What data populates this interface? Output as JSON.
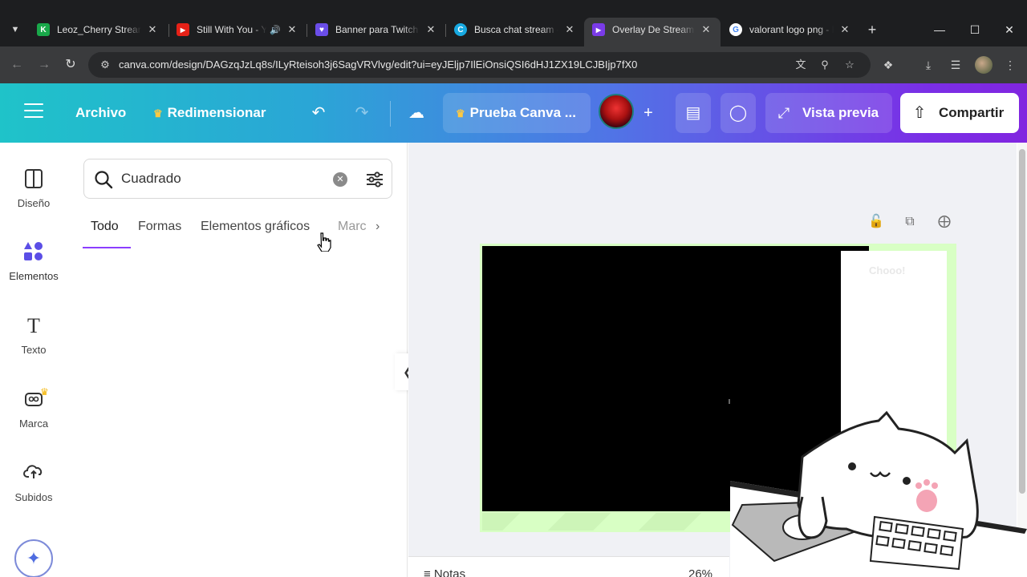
{
  "browser": {
    "tabs": [
      {
        "title": "Leoz_Cherry Stream -",
        "icon": "kick-icon",
        "color": "#19a84a",
        "glyph": "K"
      },
      {
        "title": "Still With You - Yo",
        "icon": "youtube-icon",
        "color": "#e62117",
        "glyph": "▶",
        "audio": "🔊"
      },
      {
        "title": "Banner para Twitch G",
        "icon": "shield-icon",
        "color": "#6a4de8",
        "glyph": "♥"
      },
      {
        "title": "Busca chat stream - C",
        "icon": "canva-icon",
        "color": "#17a9e1",
        "glyph": "C"
      },
      {
        "title": "Overlay De Streaming",
        "icon": "canva-icon",
        "color": "#7a3be8",
        "glyph": "▶"
      },
      {
        "title": "valorant logo png - B",
        "icon": "google-icon",
        "color": "#ffffff",
        "glyph": "G"
      }
    ],
    "new_tab": "+",
    "url": "canva.com/design/DAGzqJzLq8s/ILyRteisoh3j6SagVRVlvg/edit?ui=eyJEljp7IlEiOnsiQSI6dHJ1ZX19LCJBIjp7fX0"
  },
  "header": {
    "menu": "Archivo",
    "resize": "Redimensionar",
    "trial": "Prueba Canva ...",
    "preview": "Vista previa",
    "share": "Compartir",
    "accent": "#8b3dff"
  },
  "rail": {
    "items": [
      {
        "label": "Diseño",
        "icon": "layout-icon"
      },
      {
        "label": "Elementos",
        "icon": "elements-icon"
      },
      {
        "label": "Texto",
        "icon": "text-icon"
      },
      {
        "label": "Marca",
        "icon": "brand-icon"
      },
      {
        "label": "Subidos",
        "icon": "upload-cloud-icon"
      }
    ]
  },
  "panel": {
    "search_value": "Cuadrado",
    "tabs": [
      "Todo",
      "Formas",
      "Elementos gráficos",
      "Marc"
    ]
  },
  "canvas": {
    "watermark": "Chooo!",
    "notes": "Notas",
    "zoom": "26%"
  }
}
